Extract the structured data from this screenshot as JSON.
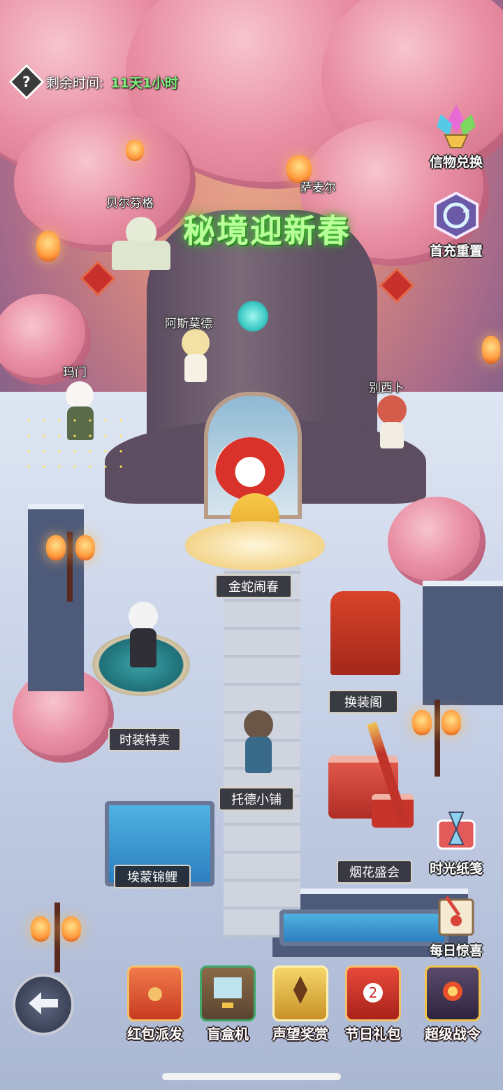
{
  "hud": {
    "timer_label": "剩余时间:",
    "timer_value": "11天1小时"
  },
  "event_title": "秘境迎新春",
  "side_buttons": {
    "token_exchange": "信物兑换",
    "recharge_reset": "首充重置",
    "time_letter": "时光纸笺",
    "daily_surprise": "每日惊喜"
  },
  "npcs": {
    "belfinger": "贝尔芬格",
    "samael": "萨麦尔",
    "asmodeus": "阿斯莫德",
    "mammon": "玛门",
    "beelzebub": "别西卜"
  },
  "locations": {
    "golden_snake": "金蛇闹春",
    "costume_sale": "时装特卖",
    "wardrobe": "换装阁",
    "tod_shop": "托德小铺",
    "fireworks": "烟花盛会",
    "koi": "埃蒙锦鲤"
  },
  "bottom_bar": [
    {
      "label": "红包派发",
      "icon": "red-envelope-icon"
    },
    {
      "label": "盲盒机",
      "icon": "blind-box-machine-icon"
    },
    {
      "label": "声望奖赏",
      "icon": "reputation-reward-icon"
    },
    {
      "label": "节日礼包",
      "icon": "festival-gift-icon"
    },
    {
      "label": "超级战令",
      "icon": "super-battle-pass-icon"
    }
  ],
  "colors": {
    "timer_value": "#7cf37c",
    "title_glow": "#4fcf3c",
    "blossom": "#e98fa4"
  }
}
